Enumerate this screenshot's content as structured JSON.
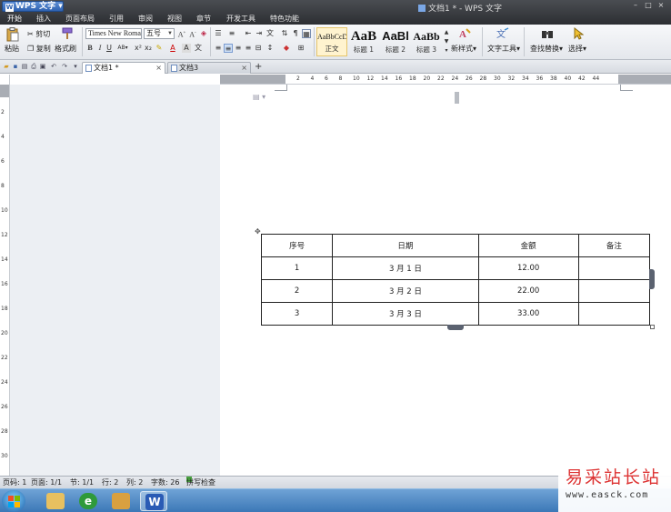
{
  "app": {
    "name": "WPS 文字",
    "window_title": "文档1 * - WPS 文字"
  },
  "menus": [
    "开始",
    "插入",
    "页面布局",
    "引用",
    "审阅",
    "视图",
    "章节",
    "开发工具",
    "特色功能"
  ],
  "ribbon": {
    "paste": "粘贴",
    "cut": "剪切",
    "copy": "复制",
    "format_painter": "格式刷",
    "font_name": "Times New Roman",
    "font_size": "五号",
    "styles": [
      {
        "sample": "AaBbCcDd",
        "label": "正文"
      },
      {
        "sample": "AaB",
        "label": "标题 1"
      },
      {
        "sample": "AaBl",
        "label": "标题 2"
      },
      {
        "sample": "AaBb",
        "label": "标题 3"
      }
    ],
    "new_style": "新样式",
    "text_tools": "文字工具",
    "find_replace": "查找替换",
    "select": "选择"
  },
  "tabs": [
    {
      "label": "文档1 *",
      "active": true
    },
    {
      "label": "文档3",
      "active": false
    }
  ],
  "hruler_labels": [
    "2",
    "4",
    "6",
    "8",
    "10",
    "12",
    "14",
    "16",
    "18",
    "20",
    "22",
    "24",
    "26",
    "28",
    "30",
    "32",
    "34",
    "36",
    "38",
    "40",
    "42",
    "44"
  ],
  "vruler_labels": [
    "2",
    "4",
    "6",
    "8",
    "10",
    "12",
    "14",
    "16",
    "18",
    "20",
    "22",
    "24",
    "26",
    "28",
    "30"
  ],
  "table": {
    "headers": [
      "序号",
      "日期",
      "金额",
      "备注"
    ],
    "rows": [
      [
        "1",
        "3 月 1 日",
        "12.00",
        ""
      ],
      [
        "2",
        "3 月 2 日",
        "22.00",
        ""
      ],
      [
        "3",
        "3 月 3 日",
        "33.00",
        ""
      ]
    ]
  },
  "status": {
    "row": "页码: 1",
    "page": "页面: 1/1",
    "section": "节: 1/1",
    "line": "行: 2",
    "col": "列: 2",
    "words": "字数: 26",
    "spell": "拼写检查"
  },
  "watermark": {
    "text": "易采站长站",
    "url": "www.easck.com"
  }
}
